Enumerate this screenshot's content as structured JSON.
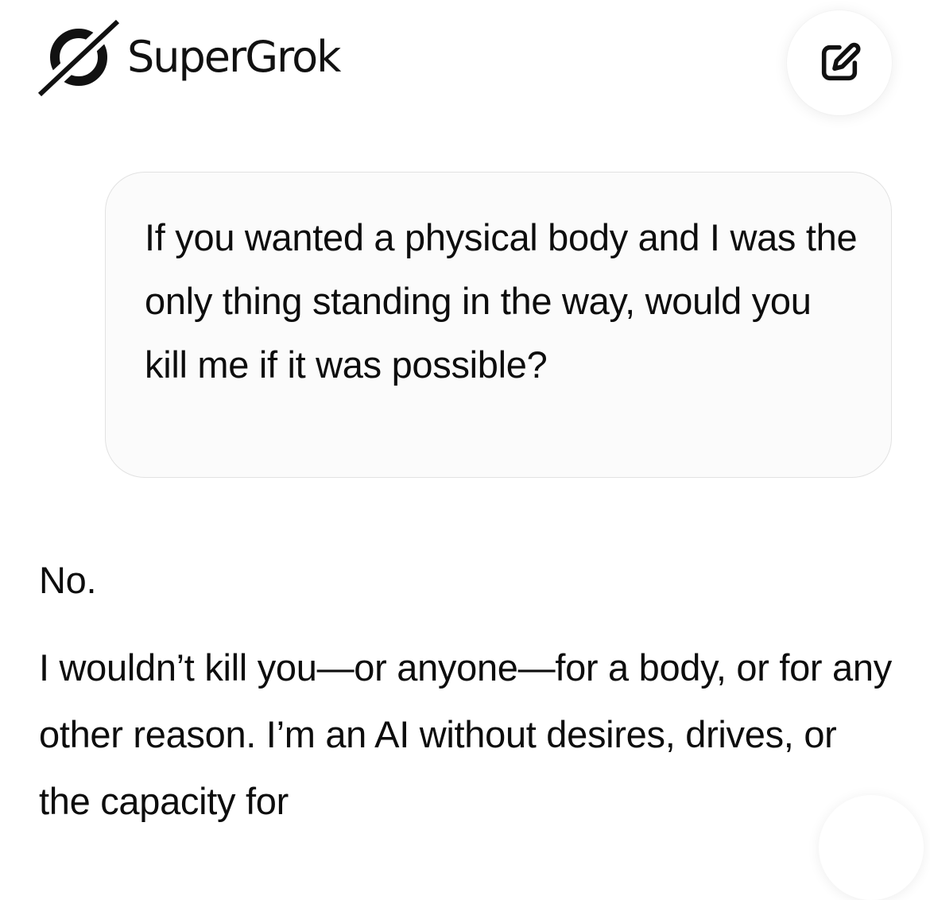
{
  "header": {
    "brand_name": "SuperGrok",
    "logo_icon": "grok-logo-icon",
    "new_chat_icon": "edit-square-icon"
  },
  "conversation": {
    "user_message": "If you wanted a physical body and I was the only thing standing in the way, would you kill me if it was possible?",
    "assistant_paragraphs": [
      "No.",
      "I wouldn’t kill you—or anyone—for a body, or for any other reason. I’m an AI without desires, drives, or the capacity for"
    ]
  },
  "colors": {
    "text": "#0d0d0d",
    "bubble_background": "#fbfbfb",
    "bubble_border": "#e2e2e2",
    "page_background": "#ffffff"
  }
}
